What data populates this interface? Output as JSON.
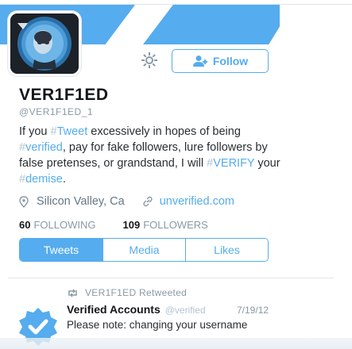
{
  "profile": {
    "name": "VER1F1ED",
    "handle": "@VER1F1ED_1",
    "location": "Silicon Valley, Ca",
    "website": "unverified.com",
    "follow_label": "Follow"
  },
  "bio": {
    "p1": "If you ",
    "h1": "#",
    "l1": "Tweet",
    "p2": " excessively in hopes of being ",
    "h2": "#",
    "l2": "verified",
    "p3": ", pay for fake followers, lure followers by false pretenses, or grandstand, I will ",
    "h3": "#",
    "l3": "VERIFY",
    "p4": " your ",
    "h4": "#",
    "l4": "demise",
    "p5": "."
  },
  "stats": {
    "following_count": "60",
    "following_label": "FOLLOWING",
    "followers_count": "109",
    "followers_label": "FOLLOWERS"
  },
  "tabs": [
    {
      "label": "Tweets",
      "active": true
    },
    {
      "label": "Media",
      "active": false
    },
    {
      "label": "Likes",
      "active": false
    }
  ],
  "tweet": {
    "retweet_label": "VER1F1ED Retweeted",
    "author": "Verified Accounts",
    "author_handle": "@verified",
    "date": "7/19/12",
    "text": "Please note: changing your username"
  },
  "colors": {
    "accent": "#55acee",
    "hashtag": "#b5c4d1",
    "muted": "#8899a6"
  },
  "icons": {
    "gear": "gear-icon",
    "follow": "add-user-icon",
    "location": "location-pin-icon",
    "website": "link-icon",
    "retweet": "retweet-icon"
  }
}
